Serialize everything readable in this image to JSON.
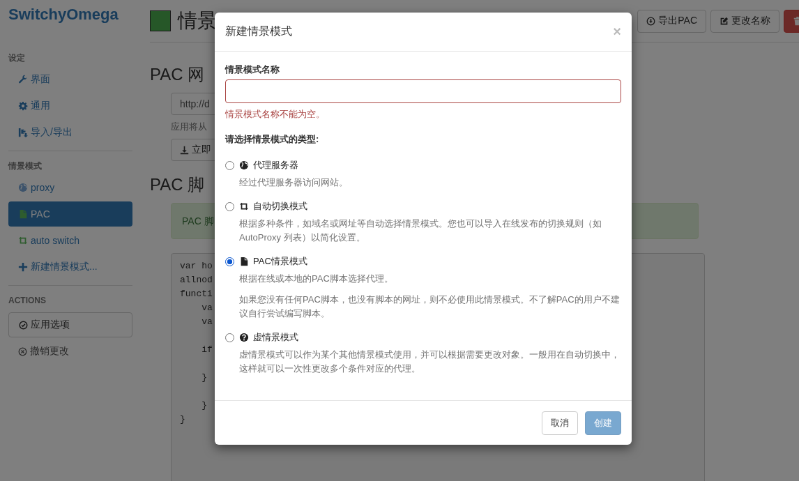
{
  "app": {
    "logo": "SwitchyOmega"
  },
  "sidebar": {
    "sections": [
      {
        "heading": "设定",
        "items": [
          {
            "label": "界面",
            "selected": false
          },
          {
            "label": "通用",
            "selected": false
          },
          {
            "label": "导入/导出",
            "selected": false
          }
        ]
      },
      {
        "heading": "情景模式",
        "items": [
          {
            "label": "proxy",
            "selected": false
          },
          {
            "label": "PAC",
            "selected": true
          },
          {
            "label": "auto switch",
            "selected": false
          },
          {
            "label": "新建情景模式...",
            "selected": false
          }
        ]
      }
    ],
    "actions": {
      "heading": "ACTIONS",
      "items": [
        {
          "label": "应用选项",
          "kind": "button"
        },
        {
          "label": "撤销更改",
          "kind": "link"
        }
      ]
    }
  },
  "profile_header": {
    "title": "情景",
    "buttons": [
      {
        "label": "导出PAC",
        "kind": "default"
      },
      {
        "label": "更改名称",
        "kind": "default"
      },
      {
        "kind": "danger"
      }
    ]
  },
  "main": {
    "url_heading": "PAC 网",
    "url_field": {
      "value": "http://d"
    },
    "help": "应用将从",
    "update_button": "立即",
    "script_heading": "PAC 脚",
    "alert": "PAC 脚",
    "code": "var ho\nallnod\nfuncti\n    va\n    va\n\n    if\n\n    }\n\n    }\n}"
  },
  "dialog": {
    "title": "新建情景模式",
    "close": "×",
    "name_label": "情景模式名称",
    "name_field": {
      "invalid": true
    },
    "error": "情景模式名称不能为空。",
    "type_label": "请选择情景模式的类型:",
    "options": [
      {
        "label": "代理服务器",
        "selected": false,
        "descriptions": [
          "经过代理服务器访问网站。"
        ]
      },
      {
        "label": "自动切换模式",
        "selected": false,
        "descriptions": [
          "根据多种条件，如域名或网址等自动选择情景模式。您也可以导入在线发布的切换规则（如 AutoProxy 列表）以简化设置。"
        ]
      },
      {
        "label": "PAC情景模式",
        "selected": true,
        "descriptions": [
          "根据在线或本地的PAC脚本选择代理。",
          "如果您没有任何PAC脚本，也没有脚本的网址，则不必使用此情景模式。不了解PAC的用户不建议自行尝试编写脚本。"
        ]
      },
      {
        "label": "虚情景模式",
        "selected": false,
        "descriptions": [
          "虚情景模式可以作为某个其他情景模式使用，并可以根据需要更改对象。一般用在自动切换中，这样就可以一次性更改多个条件对应的代理。"
        ]
      }
    ],
    "buttons": [
      {
        "label": "取消",
        "kind": "default",
        "disabled": false
      },
      {
        "label": "创建",
        "kind": "primary",
        "disabled": true
      }
    ]
  }
}
